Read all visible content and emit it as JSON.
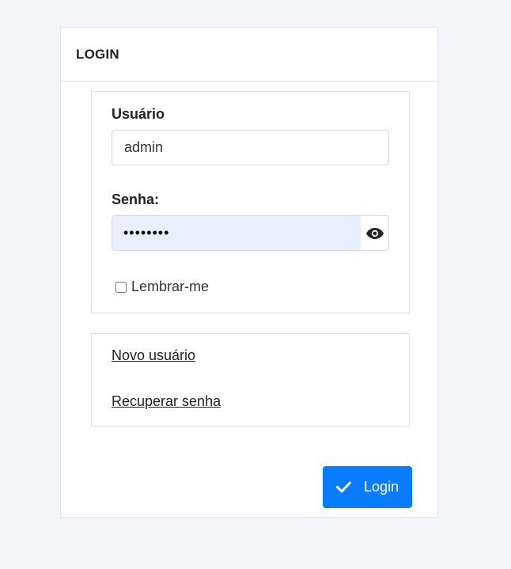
{
  "card": {
    "title": "LOGIN"
  },
  "form": {
    "username_label": "Usuário",
    "username_value": "admin",
    "password_label": "Senha:",
    "password_value": "••••••••",
    "password_toggle_icon": "eye-icon",
    "remember_label": "Lembrar-me",
    "remember_checked": false
  },
  "links": {
    "new_user": "Novo usuário",
    "recover_password": "Recuperar senha"
  },
  "actions": {
    "login_label": "Login",
    "login_icon": "check-icon"
  },
  "colors": {
    "accent": "#0a7cff",
    "background": "#f4f5f9",
    "autofill": "#e8f0fe"
  }
}
